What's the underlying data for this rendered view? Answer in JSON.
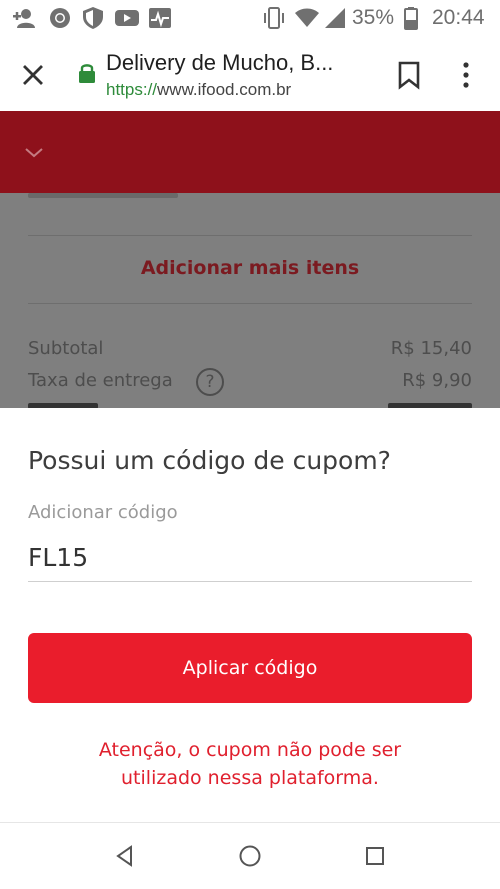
{
  "status_bar": {
    "battery_percent": "35%",
    "time": "20:44",
    "icons": [
      "person-add-icon",
      "chrome-icon",
      "shield-icon",
      "youtube-icon",
      "activity-icon",
      "vibrate-icon",
      "wifi-icon",
      "signal-icon",
      "battery-icon"
    ]
  },
  "browser": {
    "title": "Delivery de Mucho, B...",
    "url_scheme": "https://",
    "url_host": "www.ifood.com.br",
    "icons": [
      "close-icon",
      "lock-icon",
      "bookmark-icon",
      "more-vert-icon"
    ]
  },
  "app_header": {
    "color": "#8e111b",
    "icon": "chevron-down-icon"
  },
  "order": {
    "add_more_items": "Adicionar mais itens",
    "subtotal_label": "Subtotal",
    "subtotal_value": "R$ 15,40",
    "delivery_fee_label": "Taxa de entrega",
    "delivery_fee_value": "R$ 9,90",
    "help_icon_glyph": "?"
  },
  "coupon_sheet": {
    "title": "Possui um código de cupom?",
    "field_label": "Adicionar código",
    "field_value": "FL15",
    "apply_button": "Aplicar código",
    "warning_line1": "Atenção, o cupom não pode ser",
    "warning_line2": "utilizado nessa plataforma.",
    "accent_color": "#ea1d2c"
  },
  "nav_bar": {
    "icons": [
      "back-icon",
      "home-icon",
      "recents-icon"
    ]
  }
}
